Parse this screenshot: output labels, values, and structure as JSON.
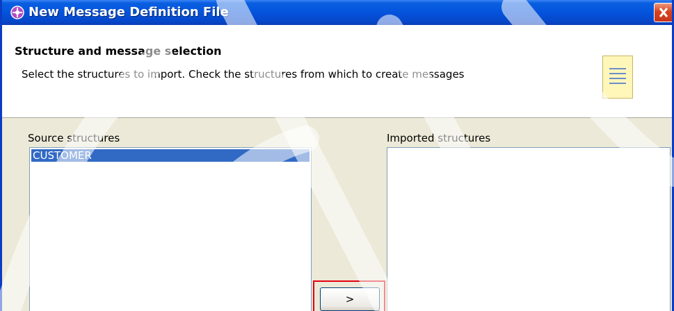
{
  "window": {
    "title": "New Message Definition File"
  },
  "header": {
    "title": "Structure and message selection",
    "description": "Select the structures to import. Check the structures from which to create messages"
  },
  "source": {
    "label": "Source structures",
    "items": [
      "CUSTOMER"
    ],
    "selected": "CUSTOMER"
  },
  "imported": {
    "label": "Imported structures",
    "items": []
  },
  "buttons": {
    "add_label": ">"
  },
  "colors": {
    "title_bar": "#0454DC",
    "selection": "#316AC5",
    "dialog_bg": "#ECE9D8",
    "highlight_box": "#E3000F"
  }
}
